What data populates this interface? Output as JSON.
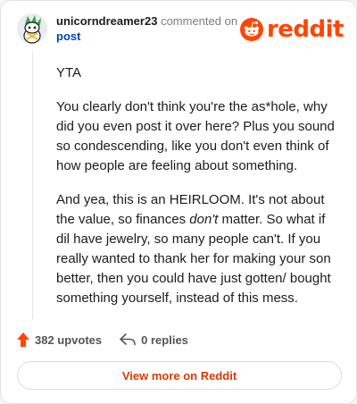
{
  "header": {
    "username": "unicorndreamer23",
    "action": "commented on",
    "post_link": "post",
    "logo_word": "reddit"
  },
  "comment": {
    "p1": "YTA",
    "p2": "You clearly don't think you're the as*hole, why did you even post it over here? Plus you sound so condescending, like you don't even think of how people are feeling about something.",
    "p3_a": "And yea, this is an HEIRLOOM. It's not about the value, so finances ",
    "p3_em": "don't",
    "p3_b": " matter. So what if dil have jewelry, so many people can't. If you really wanted to thank her for making your son better, then you could have just gotten/ bought something yourself, instead of this mess."
  },
  "footer": {
    "upvotes": "382 upvotes",
    "replies": "0 replies"
  },
  "view_more_label": "View more on Reddit",
  "colors": {
    "brand": "#ff4500",
    "link": "#0045ac",
    "view_more": "#d93a00"
  },
  "icons": {
    "avatar": "snoo-avatar",
    "logo": "reddit-snoo-icon",
    "upvote": "upvote-arrow-icon",
    "reply": "reply-arrow-icon"
  }
}
